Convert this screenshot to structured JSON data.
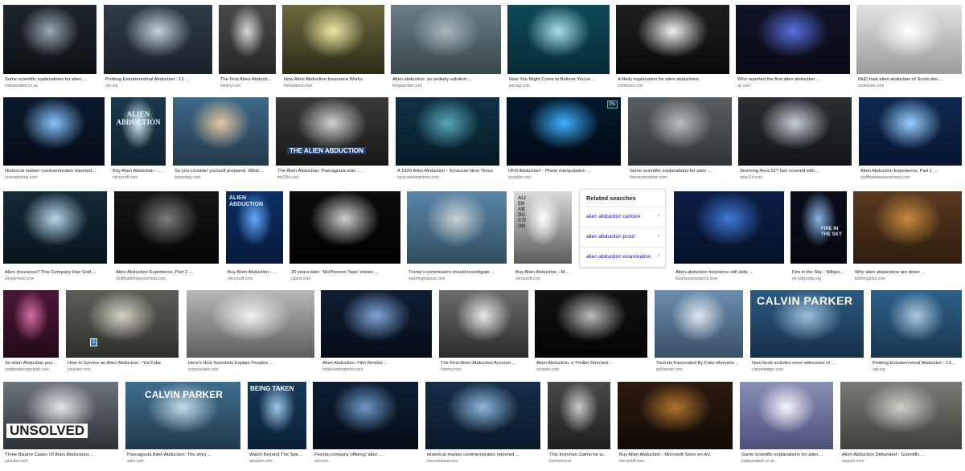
{
  "rows": [
    {
      "tiles": [
        {
          "caption": "Some scientific explanations for alien ...",
          "source": "independent.co.uk",
          "palette": [
            "#1e252c",
            "#9aa9b5",
            "#0c1014"
          ]
        },
        {
          "caption": "Probing Extraterrestrial Abduction : 13 ...",
          "source": "npr.org",
          "palette": [
            "#2f3b46",
            "#c6d2da",
            "#1a2229"
          ]
        },
        {
          "caption": "The First Alien-Abduction ...",
          "source": "history.com",
          "palette": [
            "#4a4a4a",
            "#d8d8d8",
            "#262626"
          ]
        },
        {
          "caption": "How Alien Abduction Insurance Works",
          "source": "thebalance.com",
          "palette": [
            "#6c6b3d",
            "#efe7a6",
            "#2c2b18"
          ]
        },
        {
          "caption": "Alien abduction: an unlikely solution ...",
          "source": "theguardian.com",
          "palette": [
            "#6b7d86",
            "#a9b6bc",
            "#3a474c"
          ]
        },
        {
          "caption": "How You Might Come to Believe You've ...",
          "source": "psmag.com",
          "palette": [
            "#0f4a5a",
            "#a8dfe6",
            "#072b34"
          ]
        },
        {
          "caption": "A likely explanation for alien abductions",
          "source": "irishtimes.com",
          "palette": [
            "#1f1f1f",
            "#f1f1f1",
            "#0a0a0a"
          ]
        },
        {
          "caption": "Who reported the first alien abduction ...",
          "source": "qz.com",
          "palette": [
            "#101326",
            "#5a6fe0",
            "#0a0b15"
          ]
        },
        {
          "caption": "MoD took alien abduction of Scots duo ...",
          "source": "scotsman.com",
          "palette": [
            "#e3e3e3",
            "#ffffff",
            "#9b9b9b"
          ]
        }
      ]
    },
    {
      "tiles": [
        {
          "caption": "Historical marker commemorates reported ...",
          "source": "reviewjournal.com",
          "palette": [
            "#0b1a2f",
            "#88c4ff",
            "#050b15"
          ]
        },
        {
          "caption": "Buy Alien Abduction - ...",
          "source": "microsoft.com",
          "palette": [
            "#1b3a4c",
            "#d6eef8",
            "#0e2230"
          ],
          "overlay": "ALIEN ABDUCTION",
          "overlay_color": "#e8f6ff"
        },
        {
          "caption": "So you consider yourself prepared. What ...",
          "source": "tampabay.com",
          "palette": [
            "#3e6a8a",
            "#e4c7a0",
            "#223849"
          ]
        },
        {
          "caption": "The Alien Abduction: Pascagoula man ...",
          "source": "fox10tv.com",
          "palette": [
            "#3a3a3a",
            "#d1d1d1",
            "#181818"
          ],
          "overlay": "THE ALIEN ABDUCTION",
          "overlay_color": "#ffffff"
        },
        {
          "caption": "A 1929 Alien Abduction - Syracuse New Times",
          "source": "syracusenewtimes.com",
          "palette": [
            "#0f3347",
            "#58a7b8",
            "#051a25"
          ]
        },
        {
          "caption": "UFO Abduction! - Photo manipulation ...",
          "source": "youtube.com",
          "palette": [
            "#031a2d",
            "#3fb0ff",
            "#000914"
          ],
          "badge": "Ps"
        },
        {
          "caption": "Some scientific explanations for alien ...",
          "source": "theconversation.com",
          "palette": [
            "#5a5f63",
            "#b9bcbd",
            "#303437"
          ]
        },
        {
          "caption": "Storming Area 51? Get covered with ...",
          "source": "news24.com",
          "palette": [
            "#2b2e32",
            "#c7cfd6",
            "#121417"
          ]
        },
        {
          "caption": "Alien Abduction Experience, Part 1 ...",
          "source": "stuffthatblowsyourmind.com",
          "palette": [
            "#0e2a50",
            "#9ad0ff",
            "#061531"
          ]
        }
      ]
    },
    {
      "tiles": [
        {
          "caption": "Alien Insurance? This Company Has Sold ...",
          "source": "simplemost.com",
          "palette": [
            "#152a38",
            "#b6d6e8",
            "#08141c"
          ]
        },
        {
          "caption": "Alien Abduction Experience, Part 2 ...",
          "source": "stuffthatblowsyourmind.com",
          "palette": [
            "#161616",
            "#7d7d7d",
            "#050505"
          ]
        },
        {
          "caption": "Buy Alien Abduction - ...",
          "source": "microsoft.com",
          "palette": [
            "#0b2f66",
            "#64a9ff",
            "#061a3b"
          ],
          "overlay": "ALIEN ABDUCTION",
          "overlay_color": "#dff0ff"
        },
        {
          "caption": "30 years later: 'McPherson Tape' shows ...",
          "source": "ctpost.com",
          "palette": [
            "#0c0c0c",
            "#cfcfcf",
            "#000000"
          ]
        },
        {
          "caption": "Trump's commission should investigate ...",
          "source": "washingtonpost.com",
          "palette": [
            "#5a86a8",
            "#c8d2d6",
            "#2f4d60"
          ]
        },
        {
          "caption": "Buy Alien Abduction - M...",
          "source": "microsoft.com",
          "palette": [
            "#d9d9d9",
            "#ffffff",
            "#5b5b5b"
          ],
          "overlay": "ALIEN ABDUCTION",
          "overlay_color": "#3a3a3a"
        },
        {
          "caption": "Alien-abduction insurance still sells ...",
          "source": "businessinsurance.com",
          "palette": [
            "#0d1d44",
            "#3e79d6",
            "#06102a"
          ]
        },
        {
          "caption": "Fire in the Sky - Wikipe...",
          "source": "en.wikipedia.org",
          "palette": [
            "#0a0f1c",
            "#8ab3e6",
            "#04070d"
          ],
          "overlay": "FIRE IN THE SKY",
          "overlay_color": "#cfe5ff"
        },
        {
          "caption": "Why alien abductions are down ...",
          "source": "bostonglobe.com",
          "palette": [
            "#5a3a1f",
            "#c7893e",
            "#2e1c0d"
          ]
        }
      ]
    },
    {
      "tiles": [
        {
          "caption": "Sn-alien Abduction pos...",
          "source": "snailposter.bigcartel.com",
          "palette": [
            "#4b1735",
            "#d66da5",
            "#220a18"
          ]
        },
        {
          "caption": "How to Survive an Alien Abduction - YouTube",
          "source": "youtube.com",
          "palette": [
            "#5c5f57",
            "#d6d2c4",
            "#2e302b"
          ],
          "badge": "2"
        },
        {
          "caption": "Here's How Scientists Explain Peoples ...",
          "source": "sciencealert.com",
          "palette": [
            "#b6b8ba",
            "#f0f1f2",
            "#5a5c5e"
          ]
        },
        {
          "caption": "Alien Abduction: Film Review ...",
          "source": "hollywoodreporter.com",
          "palette": [
            "#101d33",
            "#7fa6d9",
            "#050c18"
          ]
        },
        {
          "caption": "The First Alien-Abduction Account ...",
          "source": "history.com",
          "palette": [
            "#6d6d6d",
            "#e8e8e8",
            "#2a2a2a"
          ]
        },
        {
          "caption": "Alien Abduction, a Thriller Directed ...",
          "source": "nytimes.com",
          "palette": [
            "#121212",
            "#bdbdbd",
            "#030303"
          ]
        },
        {
          "caption": "Tourists Fascinated By Fake Monume...",
          "source": "gothamist.com",
          "palette": [
            "#6a8db0",
            "#dfe8ef",
            "#3a5066"
          ]
        },
        {
          "caption": "New book includes more witnesses of ...",
          "source": "clarionledger.com",
          "palette": [
            "#2c5a82",
            "#9cc1dd",
            "#14304a"
          ],
          "overlay": "CALVIN PARKER",
          "overlay_color": "#ffffff"
        },
        {
          "caption": "Probing Extraterrestrial Abduction : 13...",
          "source": "npr.org",
          "palette": [
            "#2e5f88",
            "#a9c8df",
            "#17364f"
          ]
        }
      ]
    },
    {
      "tiles": [
        {
          "caption": "Three Bizarre Cases Of Alien Abductions ...",
          "source": "youtube.com",
          "palette": [
            "#6d747b",
            "#e2e6e9",
            "#2c3135"
          ],
          "overlay": "UNSOLVED",
          "overlay_color": "#1d1d1d"
        },
        {
          "caption": "Pascagoula Alien Abduction: The story ...",
          "source": "wlox.com",
          "palette": [
            "#3f6f8f",
            "#c4dbe8",
            "#1f3a4c"
          ],
          "overlay": "CALVIN PARKER",
          "overlay_color": "#ffffff"
        },
        {
          "caption": "Watch Beyond The Spe...",
          "source": "amazon.com",
          "palette": [
            "#163a5c",
            "#9cc7e8",
            "#0a2035"
          ],
          "overlay": "BEING TAKEN",
          "overlay_color": "#ffffff"
        },
        {
          "caption": "Florida company offering 'alien ...",
          "source": "aol.com",
          "palette": [
            "#0c1e33",
            "#6f98c6",
            "#050d18"
          ]
        },
        {
          "caption": "Historical marker commemorates reported ...",
          "source": "nbcmontana.com",
          "palette": [
            "#152e4a",
            "#8db7dc",
            "#0a1828"
          ]
        },
        {
          "caption": "This Irishman claims he w...",
          "source": "irishmirror.ie",
          "palette": [
            "#4a4a4a",
            "#c9c9c9",
            "#1e1e1e"
          ]
        },
        {
          "caption": "Buy Alien Abduction - Microsoft Store en-AU",
          "source": "microsoft.com",
          "palette": [
            "#2b1a10",
            "#b0742e",
            "#120a05"
          ]
        },
        {
          "caption": "Some scientific explanations for alien ...",
          "source": "independent.co.uk",
          "palette": [
            "#8a8fb8",
            "#f7f5ff",
            "#4b4f7a"
          ]
        },
        {
          "caption": "Alien Abduction Debunked - Scientific ...",
          "source": "esquire.com",
          "palette": [
            "#7a7a74",
            "#cfcfc8",
            "#3f3f3b"
          ]
        }
      ]
    }
  ],
  "related_searches": {
    "title": "Related searches",
    "items": [
      {
        "label": "alien abduction cartoon"
      },
      {
        "label": "alien abduction proof"
      },
      {
        "label": "alien abduction examination"
      }
    ],
    "chevron": "›"
  }
}
